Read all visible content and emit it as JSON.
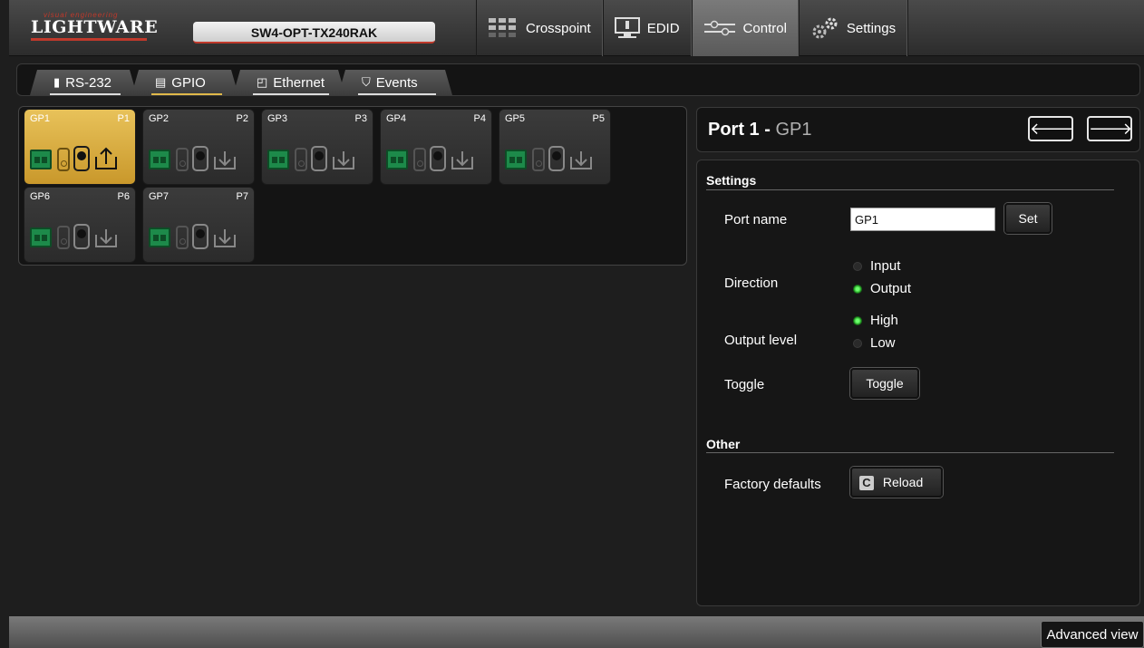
{
  "header": {
    "logo_tagline": "visual engineering",
    "logo_brand": "LIGHTWARE",
    "device_name": "SW4-OPT-TX240RAK",
    "nav": [
      {
        "label": "Crosspoint",
        "icon": "crosspoint-grid-icon"
      },
      {
        "label": "EDID",
        "icon": "monitor-icon"
      },
      {
        "label": "Control",
        "icon": "control-slider-icon",
        "active": true
      },
      {
        "label": "Settings",
        "icon": "gears-icon"
      }
    ]
  },
  "subtabs": [
    {
      "label": "RS-232",
      "icon": "serial-port-icon"
    },
    {
      "label": "GPIO",
      "icon": "gpio-connector-icon",
      "active": true
    },
    {
      "label": "Ethernet",
      "icon": "ethernet-port-icon"
    },
    {
      "label": "Events",
      "icon": "events-icon"
    }
  ],
  "ports": [
    {
      "name": "GP1",
      "id": "P1",
      "direction": "output",
      "selected": true
    },
    {
      "name": "GP2",
      "id": "P2",
      "direction": "input"
    },
    {
      "name": "GP3",
      "id": "P3",
      "direction": "input"
    },
    {
      "name": "GP4",
      "id": "P4",
      "direction": "input"
    },
    {
      "name": "GP5",
      "id": "P5",
      "direction": "input"
    },
    {
      "name": "GP6",
      "id": "P6",
      "direction": "input"
    },
    {
      "name": "GP7",
      "id": "P7",
      "direction": "input"
    }
  ],
  "detail": {
    "title_prefix": "Port 1",
    "title_sep": " - ",
    "title_name": "GP1",
    "prev_arrow": "🡐",
    "next_arrow": "🡒",
    "settings_title": "Settings",
    "port_name_label": "Port name",
    "port_name_value": "GP1",
    "set_label": "Set",
    "direction_label": "Direction",
    "direction_options": [
      {
        "label": "Input",
        "checked": false
      },
      {
        "label": "Output",
        "checked": true
      }
    ],
    "output_level_label": "Output level",
    "level_options": [
      {
        "label": "High",
        "checked": true
      },
      {
        "label": "Low",
        "checked": false
      }
    ],
    "toggle_label": "Toggle",
    "toggle_button": "Toggle",
    "other_title": "Other",
    "factory_label": "Factory defaults",
    "reload_label": "Reload"
  },
  "footer": {
    "advanced_view": "Advanced view"
  },
  "colors": {
    "selected_port": "#e0b94a",
    "connector_green": "#1d8a4a",
    "radio_on": "#3cd23c",
    "brand_red": "#c0392b"
  }
}
